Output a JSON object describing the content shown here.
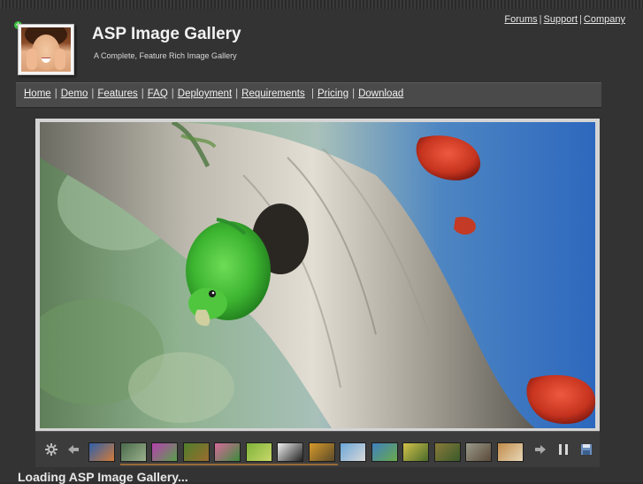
{
  "header": {
    "top_links": [
      "Forums",
      "Support",
      "Company"
    ],
    "title": "ASP Image Gallery",
    "tagline": "A Complete, Feature Rich Image Gallery"
  },
  "nav": {
    "items": [
      "Home",
      "Demo",
      "Features",
      "FAQ",
      "Deployment",
      "Requirements",
      "Pricing",
      "Download"
    ]
  },
  "gallery": {
    "toolbar": {
      "settings_icon": "gear-icon",
      "prev_icon": "arrow-left-icon",
      "next_icon": "arrow-right-icon",
      "pause_icon": "pause-icon",
      "save_icon": "save-icon"
    },
    "thumbnails": [
      {
        "name": "bird-blue",
        "color_a": "#2f5fa8",
        "color_b": "#d27b3a"
      },
      {
        "name": "bird-branch",
        "color_a": "#4a6b4c",
        "color_b": "#9bb08c"
      },
      {
        "name": "flower-purple",
        "color_a": "#b640b0",
        "color_b": "#5aa04a"
      },
      {
        "name": "frog-green",
        "color_a": "#4f7f2c",
        "color_b": "#9a6b2e"
      },
      {
        "name": "flower-pink",
        "color_a": "#d66a9a",
        "color_b": "#3d8a3d"
      },
      {
        "name": "leaf-green",
        "color_a": "#7fb23a",
        "color_b": "#c8d86a"
      },
      {
        "name": "bird-flying",
        "color_a": "#f0f0f0",
        "color_b": "#222222"
      },
      {
        "name": "butterfly-orange",
        "color_a": "#d79a2a",
        "color_b": "#5a4a2a"
      },
      {
        "name": "bird-sky",
        "color_a": "#6aa6d8",
        "color_b": "#d8d8d8"
      },
      {
        "name": "leaves-blue",
        "color_a": "#3f7fbf",
        "color_b": "#6aaa4a"
      },
      {
        "name": "butterfly-yellow",
        "color_a": "#d2c24a",
        "color_b": "#4a6a2a"
      },
      {
        "name": "turtle",
        "color_a": "#8a7a3a",
        "color_b": "#3a5a2a"
      },
      {
        "name": "owl",
        "color_a": "#9a9a8a",
        "color_b": "#5a4a3a"
      },
      {
        "name": "cat",
        "color_a": "#c08a4a",
        "color_b": "#e8d8b8"
      }
    ]
  },
  "status": {
    "loading": "Loading ASP Image Gallery..."
  },
  "colors": {
    "page_bg": "#333333",
    "nav_bg": "#4a4a4a",
    "parrot_green": "#43b63a",
    "fungus_red": "#d23a2a"
  }
}
